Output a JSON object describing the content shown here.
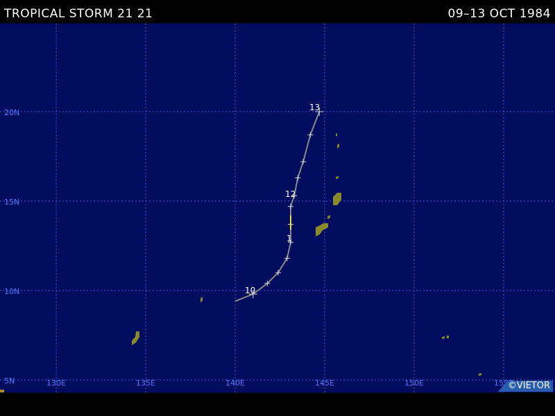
{
  "header": {
    "title": "TROPICAL STORM 21 21",
    "dates": "09–13 OCT 1984"
  },
  "map": {
    "background": "#000d5e",
    "grid_color": "#3b5bd6",
    "label_color": "#5078ff",
    "track_color": "#8a8a8a",
    "land_color": "#8a8a2a",
    "longitude_labels": [
      "130E",
      "135E",
      "140E",
      "145E",
      "150E",
      "155E"
    ],
    "latitude_labels": [
      "20N",
      "15N",
      "10N",
      "5N"
    ],
    "track": [
      [
        140.0,
        9.4
      ],
      [
        141.0,
        9.8
      ],
      [
        141.8,
        10.4
      ],
      [
        142.4,
        11.0
      ],
      [
        142.9,
        11.8
      ],
      [
        143.1,
        12.7
      ],
      [
        143.1,
        13.7
      ],
      [
        143.1,
        14.7
      ],
      [
        143.3,
        15.3
      ],
      [
        143.5,
        16.3
      ],
      [
        143.8,
        17.2
      ],
      [
        144.2,
        18.7
      ],
      [
        144.7,
        20.0
      ]
    ],
    "day_labels": [
      "10",
      "1",
      "12",
      "13"
    ]
  },
  "credit": {
    "logo": "©VIETOR"
  }
}
